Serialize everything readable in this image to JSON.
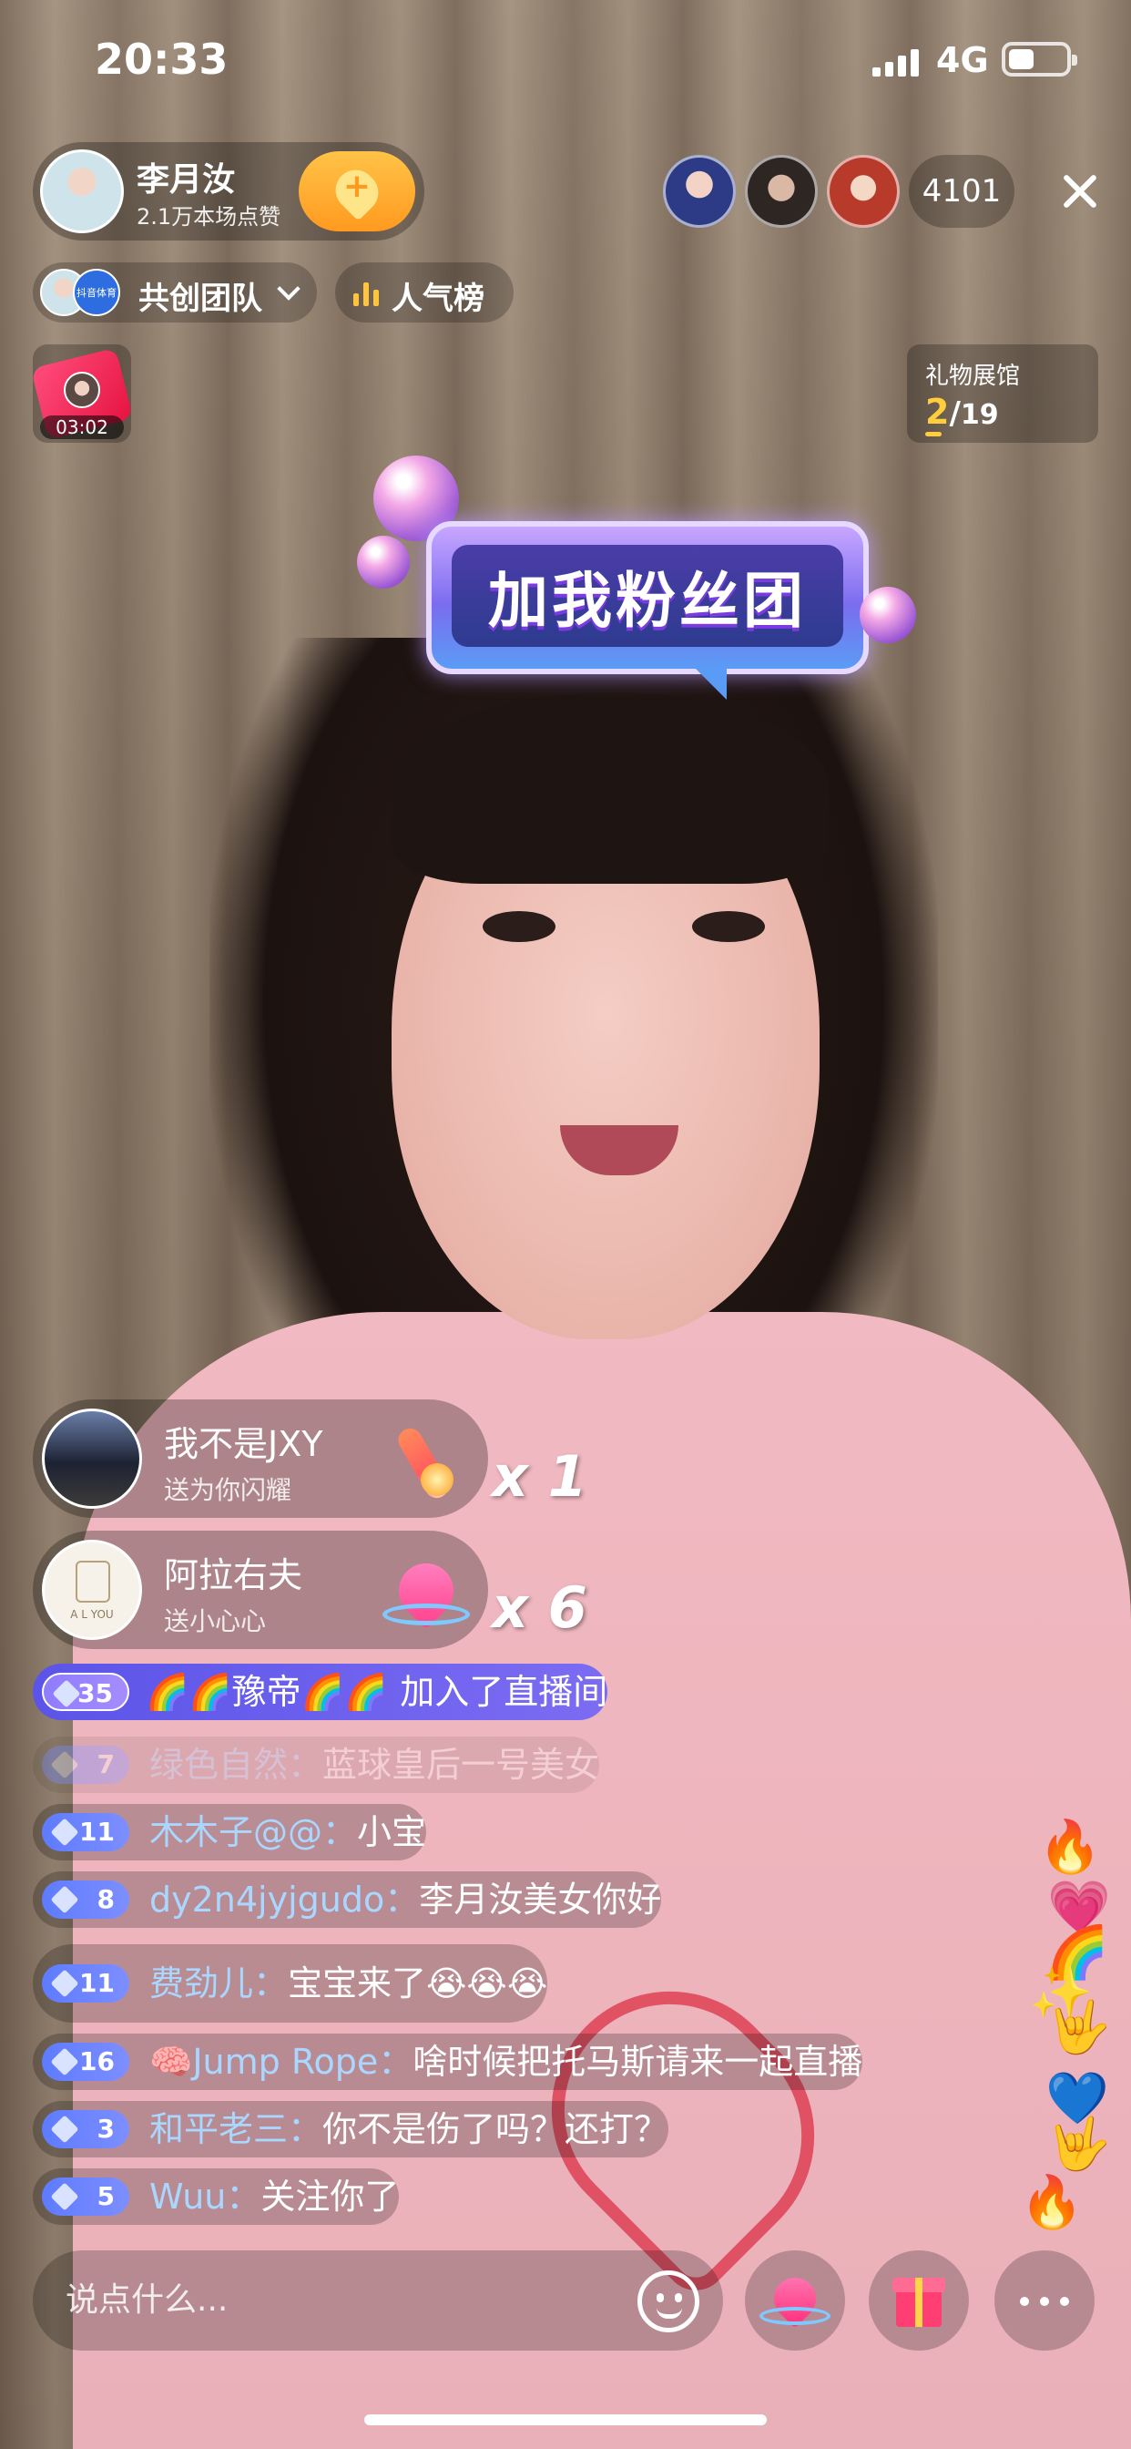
{
  "status_bar": {
    "time": "20:33",
    "network": "4G",
    "battery_level": 0.45
  },
  "host": {
    "name": "李月汝",
    "likes": "2.1万本场点赞",
    "follow_plus": "+"
  },
  "viewers": {
    "count": "4101"
  },
  "team_chip": {
    "label": "共创团队",
    "avatar_text": "抖音体育"
  },
  "popularity": {
    "label": "人气榜"
  },
  "video_thumb": {
    "duration": "03:02"
  },
  "gift_gallery": {
    "title": "礼物展馆",
    "current": "2",
    "separator": "/",
    "total": "19"
  },
  "fan_sticker": {
    "text": "加我粉丝团"
  },
  "gifts": [
    {
      "name": "我不是JXY",
      "desc": "送为你闪耀",
      "combo": "x 1",
      "icon": "torch-icon"
    },
    {
      "name": "阿拉右夫",
      "desc": "送小心心",
      "combo": "x 6",
      "icon": "heart-gift-icon",
      "avatar_text": "A L YOU"
    }
  ],
  "chat": {
    "join": {
      "level": "35",
      "user": "🌈🌈豫帝🌈🌈",
      "msg": "加入了直播间"
    },
    "messages": [
      {
        "level": "7",
        "user": "绿色自然：",
        "msg": "蓝球皇后一号美女"
      },
      {
        "level": "11",
        "user": "木木子@@：",
        "msg": "小宝"
      },
      {
        "level": "8",
        "user": "dy2n4jyjgudo：",
        "msg": "李月汝美女你好"
      },
      {
        "level": "11",
        "user": "费劲儿：",
        "msg": "宝宝来了😭😭😭"
      },
      {
        "level": "16",
        "user": "🧠Jump Rope：",
        "msg": "啥时候把托马斯请来一起直播"
      },
      {
        "level": "3",
        "user": "和平老三：",
        "msg": "你不是伤了吗？还打？"
      },
      {
        "level": "5",
        "user": "Wuu：",
        "msg": "关注你了"
      }
    ]
  },
  "floating_emojis": [
    "🔥",
    "💗",
    "🌈",
    "✨",
    "🤟",
    "💙",
    "🤟",
    "🔥"
  ],
  "bottom_bar": {
    "placeholder": "说点什么..."
  },
  "colors": {
    "follow_gold": "#ffa52e",
    "badge_blue": "#5e7bff",
    "join_purple": "#5b54e8",
    "username_blue": "#a9d7ff"
  }
}
